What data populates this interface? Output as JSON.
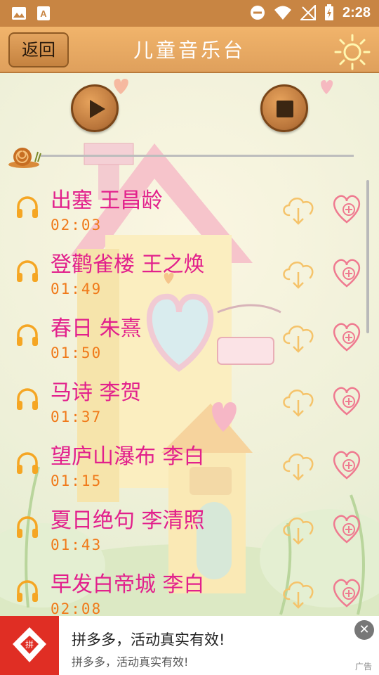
{
  "status_bar": {
    "time": "2:28",
    "icons": [
      "image-icon",
      "text-a-icon",
      "do-not-disturb-icon",
      "wifi-icon",
      "no-signal-icon",
      "battery-charging-icon"
    ]
  },
  "header": {
    "back_label": "返回",
    "title": "儿童音乐台",
    "right_icon": "sun-icon"
  },
  "player": {
    "play_icon": "play-icon",
    "stop_icon": "stop-icon",
    "progress": 0.0
  },
  "songs": [
    {
      "title": "出塞 王昌龄",
      "duration": "02:03"
    },
    {
      "title": "登鹳雀楼 王之焕",
      "duration": "01:49"
    },
    {
      "title": "春日 朱熹",
      "duration": "01:50"
    },
    {
      "title": "马诗 李贺",
      "duration": "01:37"
    },
    {
      "title": "望庐山瀑布 李白",
      "duration": "01:15"
    },
    {
      "title": "夏日绝句 李清照",
      "duration": "01:43"
    },
    {
      "title": "早发白帝城 李白",
      "duration": "02:08"
    }
  ],
  "colors": {
    "title_pink": "#e2208c",
    "time_orange": "#f07a1a",
    "header_orange": "#e8a862",
    "icon_orange": "#f5a623"
  },
  "ad": {
    "title": "拼多多，活动真实有效!",
    "subtitle": "拼多多，活动真实有效!",
    "label": "广告",
    "close_symbol": "✕"
  }
}
